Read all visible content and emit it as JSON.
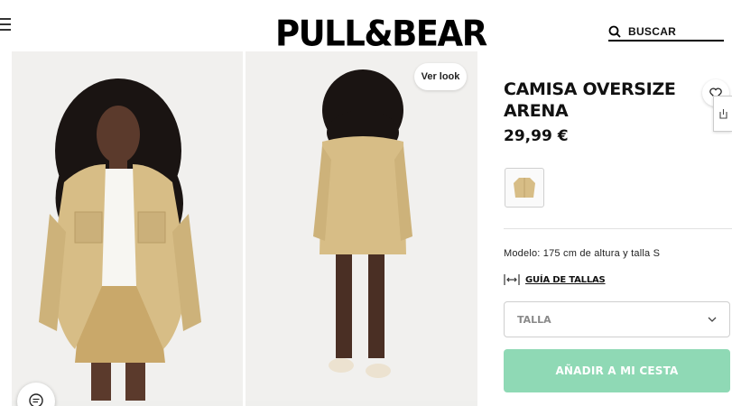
{
  "header": {
    "logo": "PULL&BEAR",
    "search_label": "BUSCAR",
    "icons": {
      "menu": "hamburger-menu-icon",
      "search": "search-icon"
    }
  },
  "gallery": {
    "ver_look_label": "Ver look",
    "photos": [
      {
        "name": "front-view",
        "description_icon": "model-photo"
      },
      {
        "name": "back-view",
        "description_icon": "model-photo"
      }
    ],
    "chat_icon": "chat-icon"
  },
  "product": {
    "title": "CAMISA OVERSIZE ARENA",
    "price": "29,99 €",
    "model_info": "Modelo: 175 cm de altura y talla S",
    "size_guide_label": "GUÍA DE TALLAS",
    "size_select": {
      "placeholder": "TALLA",
      "icon": "chevron-down-icon"
    },
    "add_to_cart_label": "AÑADIR A MI CESTA",
    "wishlist_icon": "heart-icon"
  },
  "colors": {
    "add_to_cart_bg": "#8fd9b5",
    "photo_bg": "#f1f0ee",
    "garment": "#d7bd86"
  }
}
